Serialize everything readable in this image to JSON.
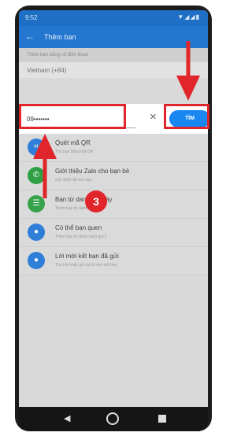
{
  "status_bar": {
    "time": "9:52",
    "icons": "▼◢◢▮"
  },
  "app_bar": {
    "back_icon": "back-arrow",
    "title": "Thêm bạn"
  },
  "subheader": "Thêm bạn bằng số điện thoại",
  "country": "Vietnam (+84)",
  "search": {
    "value": "09•••••••",
    "clear_glyph": "×",
    "find_label": "TÌM"
  },
  "list": [
    {
      "title": "Quét mã QR",
      "subtitle": "Tìm bạn bằng mã QR",
      "icon": "qr-icon",
      "color": "#2f7fd8",
      "glyph": "⌗"
    },
    {
      "title": "Giới thiệu Zalo cho bạn bè",
      "subtitle": "Gửi SMS để mời bạn",
      "icon": "phone-icon",
      "color": "#2ea043",
      "glyph": "✆"
    },
    {
      "title": "Bạn từ danh bạ máy",
      "subtitle": "Thêm bạn từ danh bạ máy",
      "icon": "contacts-icon",
      "color": "#36a24b",
      "glyph": "☰"
    },
    {
      "title": "Có thể bạn quen",
      "subtitle": "Thêm bạn từ danh sách gợi ý",
      "icon": "person-icon",
      "color": "#2f7fd8",
      "glyph": "●"
    },
    {
      "title": "Lời mời kết bạn đã gửi",
      "subtitle": "Thu hồi hoặc gửi lại lời mời kết bạn",
      "icon": "person-add-icon",
      "color": "#2f7fd8",
      "glyph": "●"
    }
  ],
  "annotation": {
    "step_number": "3",
    "highlight_color": "#e0252b"
  },
  "nav": {
    "back": "◀"
  }
}
